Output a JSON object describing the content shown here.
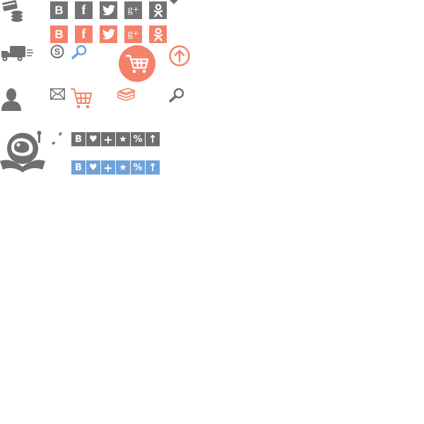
{
  "colors": {
    "gray": "#6f6f6f",
    "coral": "#f4826a",
    "blue": "#6ea2da"
  },
  "social_gray": [
    {
      "icon": "vk-icon",
      "glyph": "B"
    },
    {
      "icon": "facebook-icon",
      "glyph": "f"
    },
    {
      "icon": "twitter-icon",
      "glyph": ""
    },
    {
      "icon": "google-plus-icon",
      "glyph": "g+"
    },
    {
      "icon": "odnoklassniki-icon",
      "glyph": ""
    }
  ],
  "social_coral": [
    {
      "icon": "vk-icon",
      "glyph": "B"
    },
    {
      "icon": "facebook-icon",
      "glyph": "f"
    },
    {
      "icon": "twitter-icon",
      "glyph": ""
    },
    {
      "icon": "google-plus-icon",
      "glyph": "g+"
    },
    {
      "icon": "odnoklassniki-icon",
      "glyph": ""
    }
  ],
  "action_bar": [
    {
      "icon": "vk-icon",
      "glyph": "B"
    },
    {
      "icon": "heart-icon",
      "glyph": "♥"
    },
    {
      "icon": "plus-icon",
      "glyph": "+"
    },
    {
      "icon": "star-icon",
      "glyph": "★"
    },
    {
      "icon": "percent-icon",
      "glyph": "%"
    },
    {
      "icon": "arrow-up-icon",
      "glyph": "↑"
    }
  ]
}
